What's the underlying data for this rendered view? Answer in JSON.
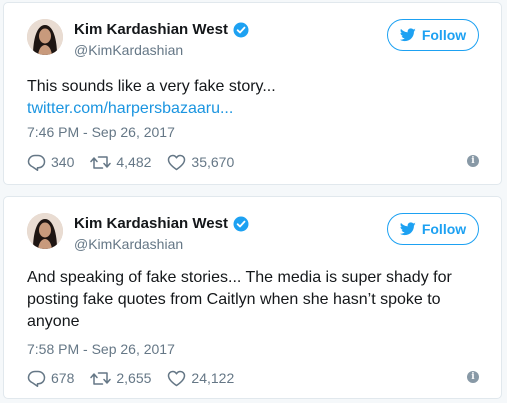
{
  "colors": {
    "accent": "#1da1f2",
    "link": "#1b95e0",
    "muted": "#657786"
  },
  "tweets": [
    {
      "author": {
        "name": "Kim Kardashian West",
        "handle": "@KimKardashian",
        "verified": true
      },
      "follow_label": "Follow",
      "text": "This sounds like a very fake story...",
      "link": "twitter.com/harpersbazaaru...",
      "timestamp": "7:46 PM - Sep 26, 2017",
      "replies": "340",
      "retweets": "4,482",
      "likes": "35,670"
    },
    {
      "author": {
        "name": "Kim Kardashian West",
        "handle": "@KimKardashian",
        "verified": true
      },
      "follow_label": "Follow",
      "text": "And speaking of fake stories... The media is super shady for posting fake quotes from Caitlyn when she hasn’t spoke to anyone",
      "timestamp": "7:58 PM - Sep 26, 2017",
      "replies": "678",
      "retweets": "2,655",
      "likes": "24,122"
    }
  ],
  "icons": [
    "avatar",
    "verified-badge-icon",
    "twitter-bird-icon",
    "reply-icon",
    "retweet-icon",
    "like-icon",
    "info-icon"
  ]
}
